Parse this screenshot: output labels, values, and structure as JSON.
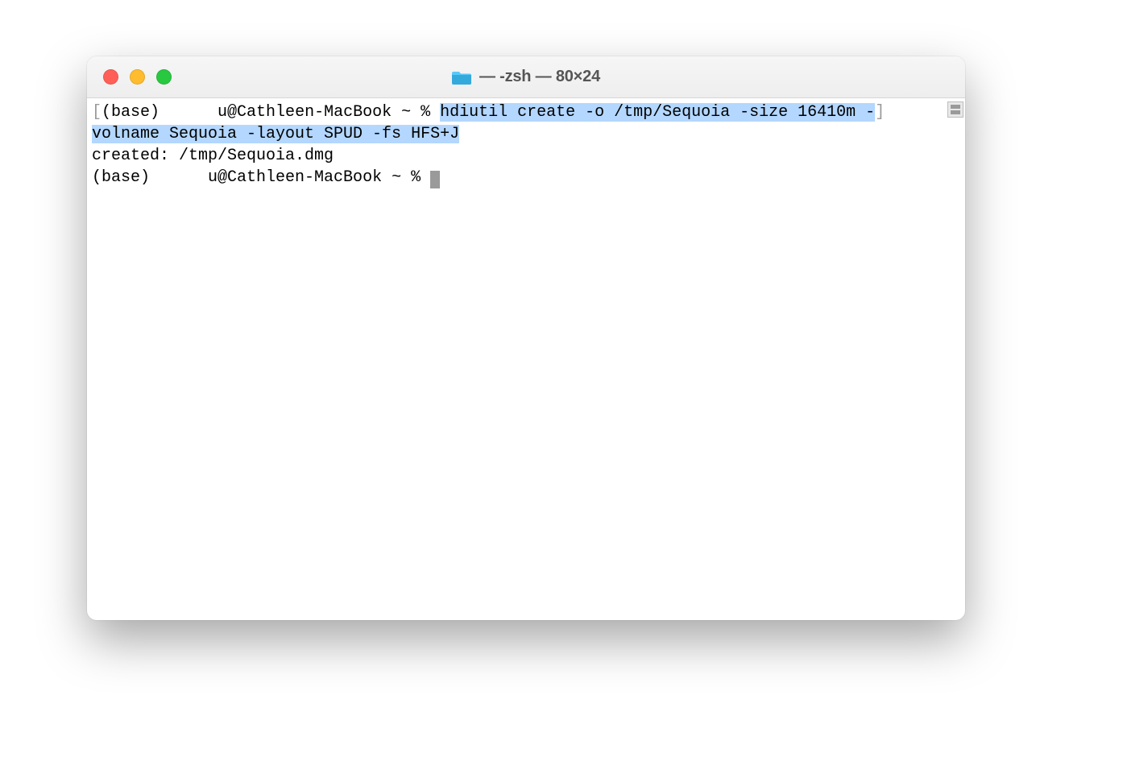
{
  "window": {
    "title_suffix": " — -zsh — 80×24"
  },
  "terminal": {
    "line1": {
      "open_bracket": "[",
      "prompt_prefix": "(base) ",
      "user_obscured": "     ",
      "prompt_host": "u@Cathleen-MacBook ~ % ",
      "cmd_part1": "hdiutil create -o /tmp/Sequoia -size 16410m -",
      "close_bracket": "]"
    },
    "line2_cmd_part2": "volname Sequoia -layout SPUD -fs HFS+J",
    "line3_output": "created: /tmp/Sequoia.dmg",
    "line4": {
      "prompt_prefix": "(base) ",
      "user_obscured": "     ",
      "prompt_host": "u@Cathleen-MacBook ~ % "
    }
  }
}
